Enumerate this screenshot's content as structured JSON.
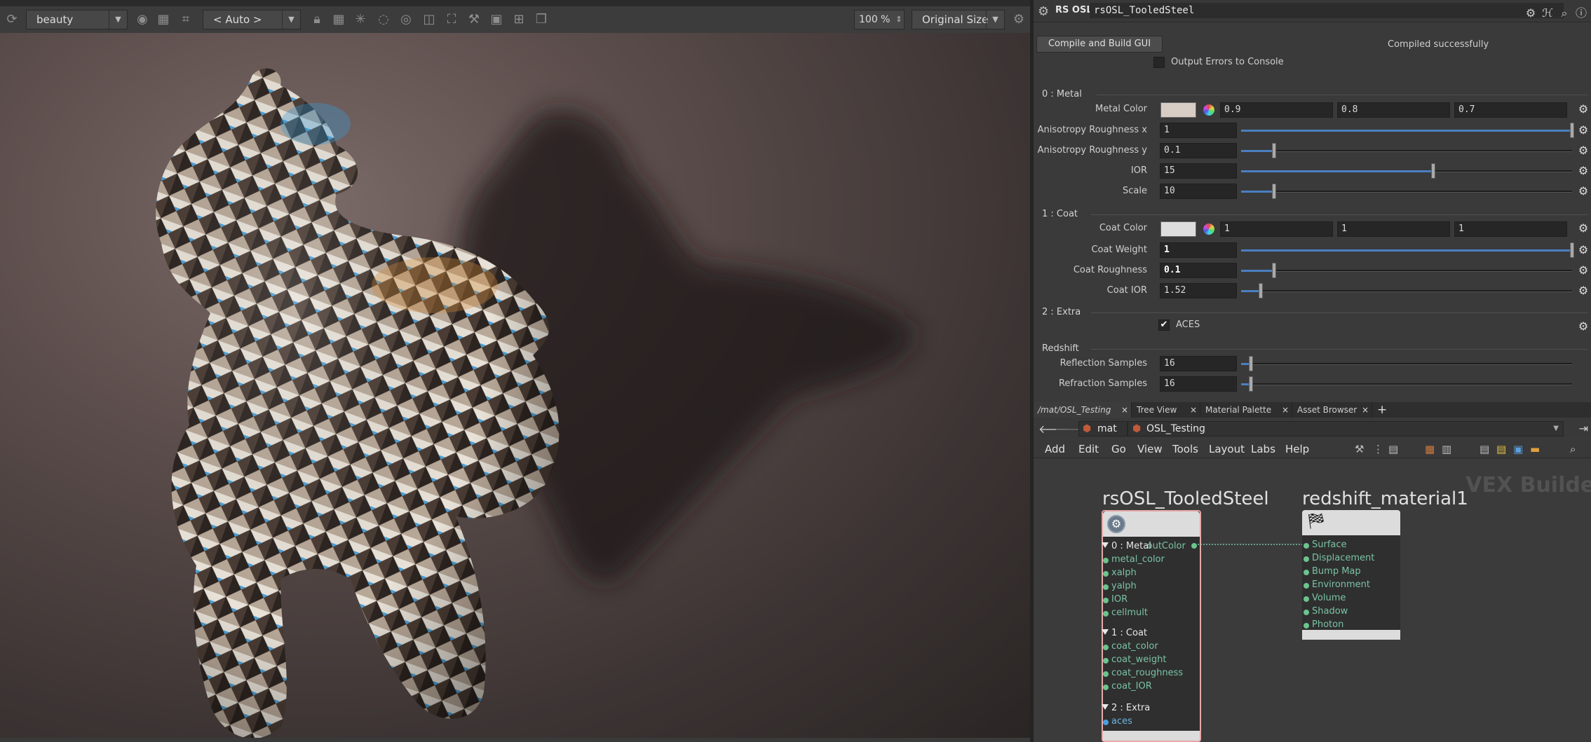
{
  "viewer": {
    "aov": "beauty",
    "camera": "< Auto >",
    "zoom": "100 %",
    "size_mode": "Original Size"
  },
  "param": {
    "type": "RS OSL",
    "node_name": "rsOSL_TooledSteel",
    "compile_button": "Compile and Build GUI",
    "compile_status": "Compiled successfully",
    "output_errors_label": "Output Errors to Console",
    "sections": {
      "metal": "0 : Metal",
      "coat": "1 : Coat",
      "extra": "2 : Extra",
      "redshift": "Redshift"
    },
    "metal_color": {
      "label": "Metal Color",
      "r": "0.9",
      "g": "0.8",
      "b": "0.7",
      "swatch": "#d8cdc4"
    },
    "aniso_x": {
      "label": "Anisotropy Roughness x",
      "value": "1",
      "fraction": 1.0
    },
    "aniso_y": {
      "label": "Anisotropy Roughness y",
      "value": "0.1",
      "fraction": 0.1
    },
    "ior": {
      "label": "IOR",
      "value": "15",
      "fraction": 0.58
    },
    "scale": {
      "label": "Scale",
      "value": "10",
      "fraction": 0.1
    },
    "coat_color": {
      "label": "Coat Color",
      "r": "1",
      "g": "1",
      "b": "1",
      "swatch": "#dedede"
    },
    "coat_weight": {
      "label": "Coat Weight",
      "value": "1",
      "fraction": 1.0
    },
    "coat_roughness": {
      "label": "Coat Roughness",
      "value": "0.1",
      "fraction": 0.1
    },
    "coat_ior": {
      "label": "Coat IOR",
      "value": "1.52",
      "fraction": 0.06
    },
    "aces": {
      "label": "ACES",
      "checked": true
    },
    "reflection_samples": {
      "label": "Reflection Samples",
      "value": "16",
      "fraction": 0.03
    },
    "refraction_samples": {
      "label": "Refraction Samples",
      "value": "16",
      "fraction": 0.03
    }
  },
  "tabs": [
    "/mat/OSL_Testing",
    "Tree View",
    "Material Palette",
    "Asset Browser"
  ],
  "path": {
    "root": "mat",
    "current": "OSL_Testing"
  },
  "menu": [
    "Add",
    "Edit",
    "Go",
    "View",
    "Tools",
    "Layout",
    "Labs",
    "Help"
  ],
  "network": {
    "watermark": "VEX Builder",
    "osl_node": {
      "title": "rsOSL_TooledSteel",
      "output": "outColor",
      "group_metal": "0 : Metal",
      "metal_inputs": [
        "metal_color",
        "xalph",
        "yalph",
        "IOR",
        "cellmult"
      ],
      "group_coat": "1 : Coat",
      "coat_inputs": [
        "coat_color",
        "coat_weight",
        "coat_roughness",
        "coat_IOR"
      ],
      "group_extra": "2 : Extra",
      "extra_inputs": [
        "aces"
      ]
    },
    "material_node": {
      "title": "redshift_material1",
      "inputs": [
        "Surface",
        "Displacement",
        "Bump Map",
        "Environment",
        "Volume",
        "Shadow",
        "Photon"
      ]
    }
  },
  "colors": {
    "accent": "#4a7fc0",
    "port_green": "#6cc48e",
    "port_blue": "#4a9ee0"
  }
}
